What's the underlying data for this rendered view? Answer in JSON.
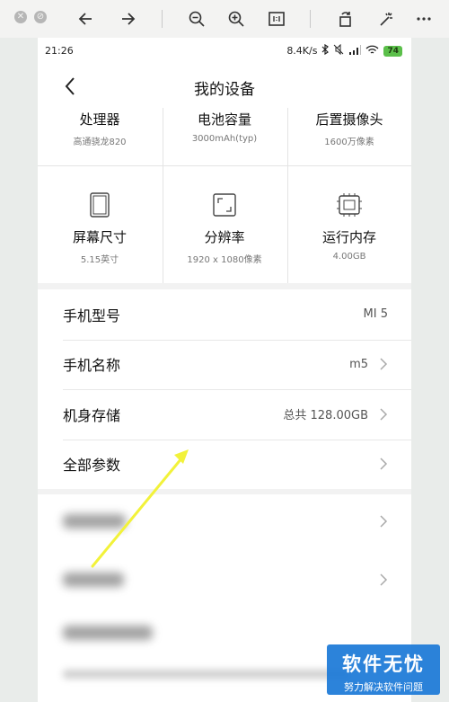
{
  "status_bar": {
    "time": "21:26",
    "net_speed": "8.4K/s",
    "battery": "74"
  },
  "header": {
    "title": "我的设备"
  },
  "specs": [
    {
      "label": "处理器",
      "value": "高通骁龙820",
      "icon": "processor-icon"
    },
    {
      "label": "电池容量",
      "value": "3000mAh(typ)",
      "icon": "battery-icon"
    },
    {
      "label": "后置摄像头",
      "value": "1600万像素",
      "icon": "camera-icon"
    },
    {
      "label": "屏幕尺寸",
      "value": "5.15英寸",
      "icon": "screen-icon"
    },
    {
      "label": "分辨率",
      "value": "1920 x 1080像素",
      "icon": "resolution-icon"
    },
    {
      "label": "运行内存",
      "value": "4.00GB",
      "icon": "memory-icon"
    }
  ],
  "list": [
    {
      "label": "手机型号",
      "value": "MI 5",
      "chevron": false
    },
    {
      "label": "手机名称",
      "value": "m5",
      "chevron": true
    },
    {
      "label": "机身存储",
      "value": "总共 128.00GB",
      "chevron": true
    },
    {
      "label": "全部参数",
      "value": "",
      "chevron": true
    }
  ],
  "watermark": {
    "title": "软件无忧",
    "subtitle": "努力解决软件问题"
  },
  "colors": {
    "accent_arrow": "#f2f23a",
    "watermark_bg": "#1a78d7",
    "battery": "#5bbf4a"
  }
}
